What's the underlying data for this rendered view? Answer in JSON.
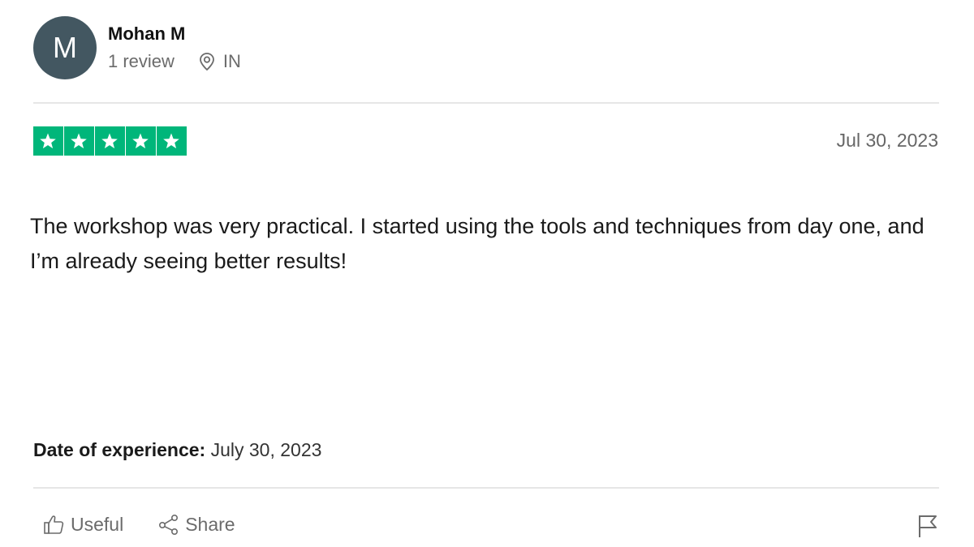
{
  "reviewer": {
    "initial": "M",
    "name": "Mohan M",
    "review_count": "1 review",
    "country": "IN"
  },
  "rating": {
    "stars": 5,
    "max": 5,
    "color": "#00b67a"
  },
  "review": {
    "date": "Jul 30, 2023",
    "text": "The workshop was very practical. I started using the tools and techniques from day one, and I’m already seeing better results!"
  },
  "experience": {
    "label": "Date of experience:",
    "value": "July 30, 2023"
  },
  "actions": {
    "useful_label": "Useful",
    "share_label": "Share"
  },
  "icons": {
    "location": "location-pin-icon",
    "useful": "thumbs-up-icon",
    "share": "share-icon",
    "report": "flag-icon",
    "star": "star-icon"
  },
  "colors": {
    "avatar_bg": "#435761",
    "star_green": "#00b67a"
  }
}
